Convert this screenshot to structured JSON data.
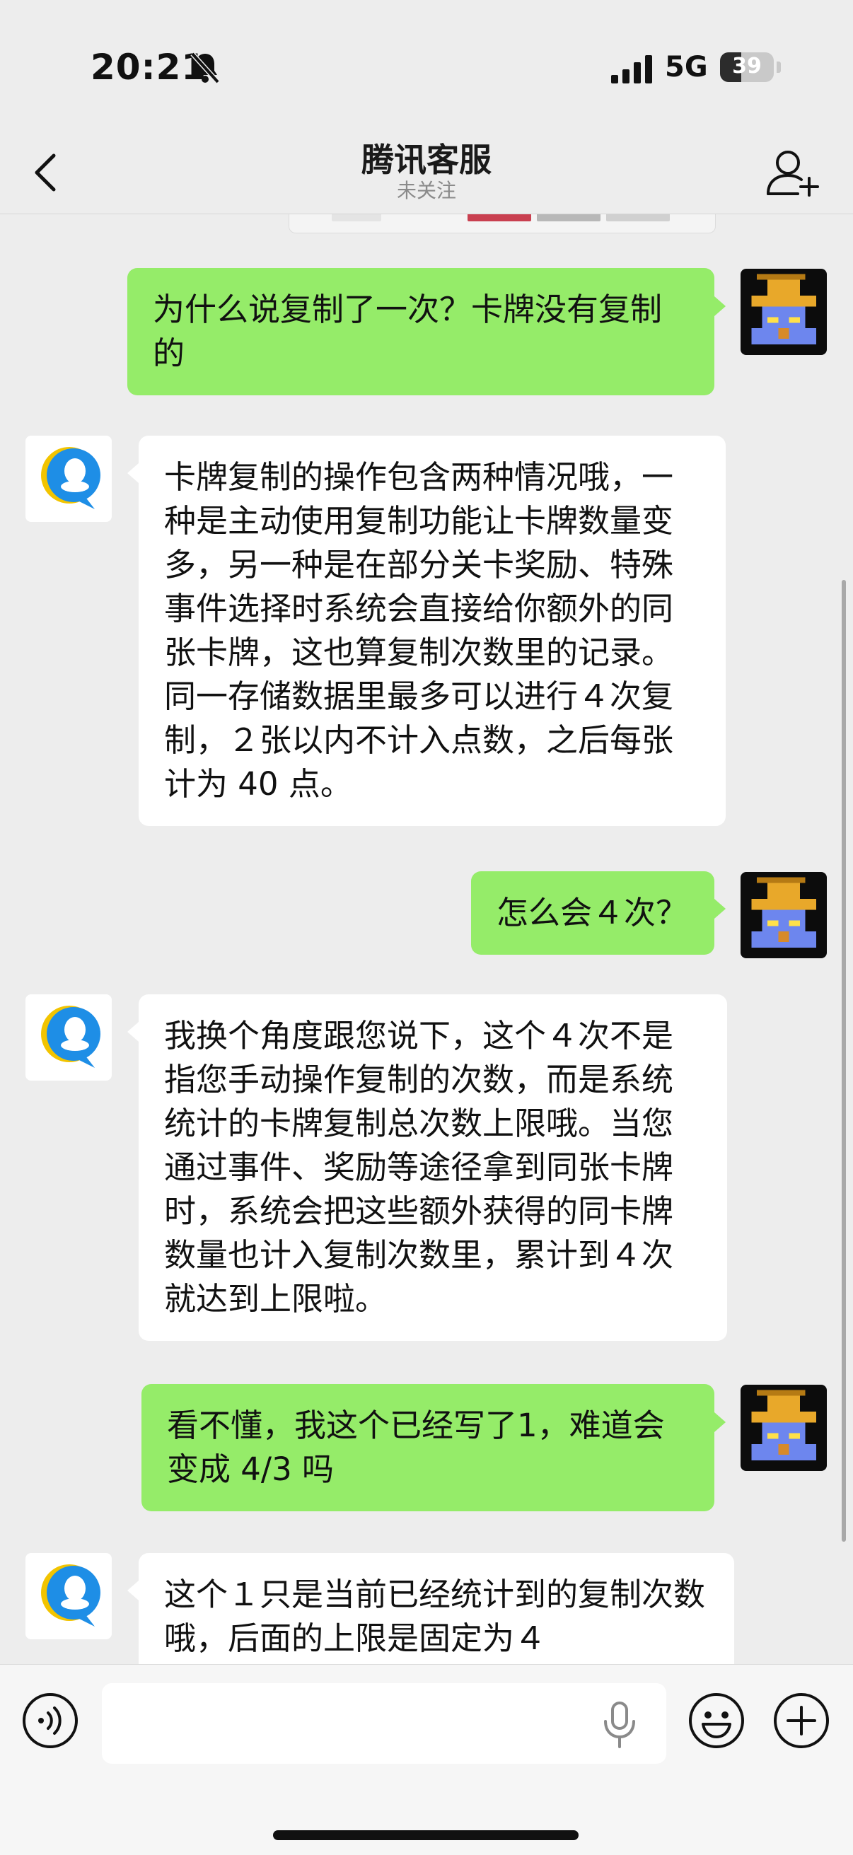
{
  "status_bar": {
    "time": "20:21",
    "network": "5G",
    "battery": "39"
  },
  "nav": {
    "title": "腾讯客服",
    "subtitle": "未关注"
  },
  "messages": [
    {
      "role": "user",
      "text": "为什么说复制了一次？卡牌没有复制的"
    },
    {
      "role": "bot",
      "text": "卡牌复制的操作包含两种情况哦，一种是主动使用复制功能让卡牌数量变多，另一种是在部分关卡奖励、特殊事件选择时系统会直接给你额外的同张卡牌，这也算复制次数里的记录。同一存储数据里最多可以进行４次复制，２张以内不计入点数，之后每张计为 40 点。"
    },
    {
      "role": "user",
      "text": "怎么会４次？"
    },
    {
      "role": "bot",
      "text": "我换个角度跟您说下，这个４次不是指您手动操作复制的次数，而是系统统计的卡牌复制总次数上限哦。当您通过事件、奖励等途径拿到同张卡牌时，系统会把这些额外获得的同卡牌数量也计入复制次数里，累计到４次就达到上限啦。"
    },
    {
      "role": "user",
      "text": "看不懂，我这个已经写了1，难道会变成 4/3 吗"
    },
    {
      "role": "bot",
      "text": "这个１只是当前已经统计到的复制次数哦，后面的上限是固定为４"
    }
  ],
  "input": {
    "placeholder": ""
  },
  "icons": {
    "bell": "bell-slash-icon",
    "back": "chevron-left-icon",
    "add_friend": "add-friend-icon",
    "voice": "voice-icon",
    "mic": "microphone-icon",
    "emoji": "emoji-icon",
    "plus": "plus-icon"
  },
  "colors": {
    "user_bubble": "#95ec69",
    "bot_bubble": "#ffffff",
    "background": "#ededed"
  }
}
